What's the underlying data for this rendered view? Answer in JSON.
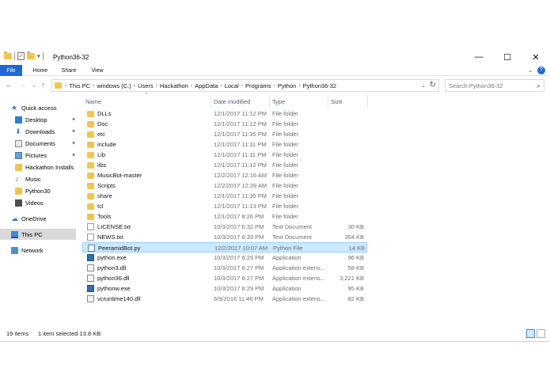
{
  "window": {
    "title": "Python36-32",
    "controls": {
      "minimize": "—",
      "maximize": "☐",
      "close": "✕"
    }
  },
  "ribbon": {
    "tabs": [
      "File",
      "Home",
      "Share",
      "View"
    ],
    "help": "?"
  },
  "address": {
    "crumbs": [
      "This PC",
      "windows (C:)",
      "Users",
      "Hackathon",
      "AppData",
      "Local",
      "Programs",
      "Python",
      "Python36-32"
    ],
    "separator": "›"
  },
  "search": {
    "placeholder": "Search Python36-32"
  },
  "sidebar": {
    "items": [
      {
        "label": "Quick access",
        "icon": "star-icon"
      },
      {
        "label": "Desktop",
        "icon": "desktop-icon",
        "pinned": true
      },
      {
        "label": "Downloads",
        "icon": "download-icon",
        "pinned": true
      },
      {
        "label": "Documents",
        "icon": "documents-icon",
        "pinned": true
      },
      {
        "label": "Pictures",
        "icon": "pictures-icon",
        "pinned": true
      },
      {
        "label": "Hackathon Installs",
        "icon": "folder-icon"
      },
      {
        "label": "Music",
        "icon": "music-icon"
      },
      {
        "label": "Python30",
        "icon": "folder-icon"
      },
      {
        "label": "Videos",
        "icon": "videos-icon"
      },
      {
        "label": "OneDrive",
        "icon": "onedrive-icon"
      },
      {
        "label": "This PC",
        "icon": "this-pc-icon",
        "selected": true
      },
      {
        "label": "Network",
        "icon": "network-icon"
      }
    ]
  },
  "columns": {
    "name": "Name",
    "date": "Date modified",
    "type": "Type",
    "size": "Size"
  },
  "files": [
    {
      "name": "DLLs",
      "date": "12/1/2017 11:12 PM",
      "type": "File folder",
      "size": "",
      "kind": "folder"
    },
    {
      "name": "Doc",
      "date": "12/1/2017 11:12 PM",
      "type": "File folder",
      "size": "",
      "kind": "folder"
    },
    {
      "name": "etc",
      "date": "12/1/2017 11:35 PM",
      "type": "File folder",
      "size": "",
      "kind": "folder"
    },
    {
      "name": "include",
      "date": "12/1/2017 11:11 PM",
      "type": "File folder",
      "size": "",
      "kind": "folder"
    },
    {
      "name": "Lib",
      "date": "12/1/2017 11:11 PM",
      "type": "File folder",
      "size": "",
      "kind": "folder"
    },
    {
      "name": "libs",
      "date": "12/1/2017 11:12 PM",
      "type": "File folder",
      "size": "",
      "kind": "folder"
    },
    {
      "name": "MusicBot-master",
      "date": "12/2/2017 12:16 AM",
      "type": "File folder",
      "size": "",
      "kind": "folder"
    },
    {
      "name": "Scripts",
      "date": "12/2/2017 12:39 AM",
      "type": "File folder",
      "size": "",
      "kind": "folder"
    },
    {
      "name": "share",
      "date": "12/1/2017 11:35 PM",
      "type": "File folder",
      "size": "",
      "kind": "folder"
    },
    {
      "name": "tcl",
      "date": "12/1/2017 11:13 PM",
      "type": "File folder",
      "size": "",
      "kind": "folder"
    },
    {
      "name": "Tools",
      "date": "12/1/2017 8:26 PM",
      "type": "File folder",
      "size": "",
      "kind": "folder"
    },
    {
      "name": "LICENSE.txt",
      "date": "10/3/2017 6:32 PM",
      "type": "Text Document",
      "size": "30 KB",
      "kind": "txt"
    },
    {
      "name": "NEWS.txt",
      "date": "10/3/2017 6:33 PM",
      "type": "Text Document",
      "size": "354 KB",
      "kind": "txt"
    },
    {
      "name": "PeeramidBot.py",
      "date": "12/2/2017 10:07 AM",
      "type": "Python File",
      "size": "14 KB",
      "kind": "py",
      "selected": true
    },
    {
      "name": "python.exe",
      "date": "10/3/2017 6:29 PM",
      "type": "Application",
      "size": "96 KB",
      "kind": "exe"
    },
    {
      "name": "python3.dll",
      "date": "10/3/2017 6:27 PM",
      "type": "Application extens...",
      "size": "58 KB",
      "kind": "dll"
    },
    {
      "name": "python36.dll",
      "date": "10/3/2017 6:27 PM",
      "type": "Application extens...",
      "size": "3,221 KB",
      "kind": "dll"
    },
    {
      "name": "pythonw.exe",
      "date": "10/3/2017 6:29 PM",
      "type": "Application",
      "size": "95 KB",
      "kind": "exe"
    },
    {
      "name": "vcruntime140.dll",
      "date": "6/9/2016 11:46 PM",
      "type": "Application extens...",
      "size": "82 KB",
      "kind": "dll"
    }
  ],
  "status": {
    "items": "19 items",
    "selected": "1 item selected  13.8 KB"
  },
  "colors": {
    "accent": "#1f6ad1",
    "selection": "#cce8ff",
    "folder": "#f3c64b"
  }
}
